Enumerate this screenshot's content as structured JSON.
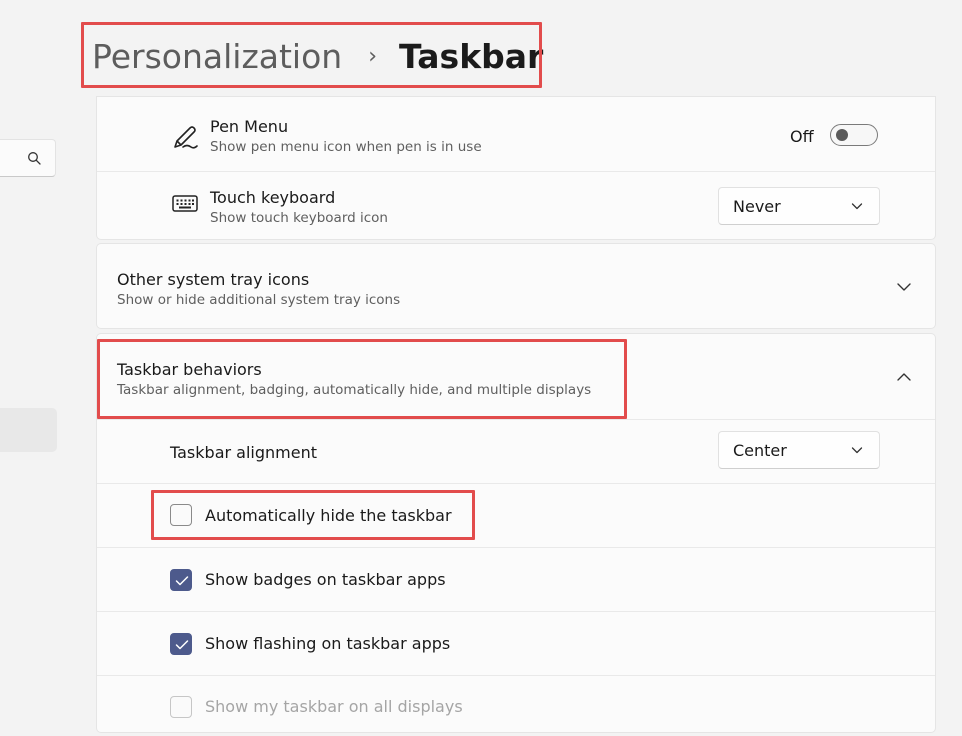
{
  "nav": {
    "search_icon": "search-icon"
  },
  "header": {
    "parent": "Personalization",
    "separator": "›",
    "current": "Taskbar"
  },
  "tray_card": {
    "pen_menu": {
      "icon": "pen-icon",
      "title": "Pen Menu",
      "subtitle": "Show pen menu icon when pen is in use",
      "toggle_label": "Off",
      "toggle_on": false
    },
    "touch_keyboard": {
      "icon": "keyboard-icon",
      "title": "Touch keyboard",
      "subtitle": "Show touch keyboard icon",
      "value": "Never"
    }
  },
  "other_tray": {
    "title": "Other system tray icons",
    "subtitle": "Show or hide additional system tray icons",
    "expanded": false
  },
  "behaviors": {
    "title": "Taskbar behaviors",
    "subtitle": "Taskbar alignment, badging, automatically hide, and multiple displays",
    "expanded": true,
    "alignment": {
      "label": "Taskbar alignment",
      "value": "Center"
    },
    "options": [
      {
        "label": "Automatically hide the taskbar",
        "checked": false,
        "disabled": false
      },
      {
        "label": "Show badges on taskbar apps",
        "checked": true,
        "disabled": false
      },
      {
        "label": "Show flashing on taskbar apps",
        "checked": true,
        "disabled": false
      },
      {
        "label": "Show my taskbar on all displays",
        "checked": false,
        "disabled": true
      }
    ]
  },
  "colors": {
    "highlight": "#e24c4c",
    "checkbox_accent": "#4d5a8c"
  }
}
